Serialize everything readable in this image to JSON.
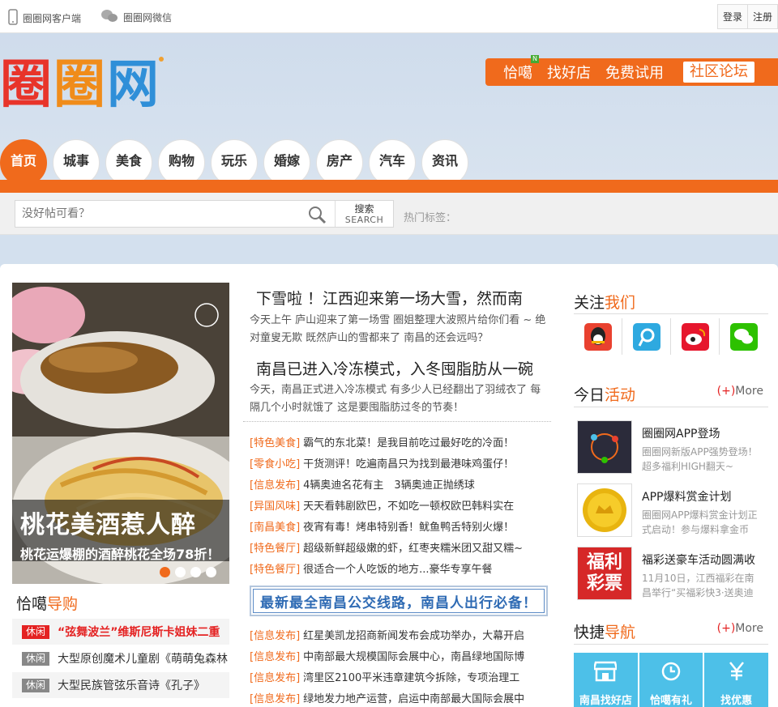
{
  "topbar": {
    "client": "圈圈网客户端",
    "wechat": "圈圈网微信",
    "login": "登录",
    "register": "注册"
  },
  "logo": {
    "chars": [
      "圈",
      "圈",
      "网"
    ]
  },
  "topnav": {
    "items": [
      "恰噶",
      "找好店",
      "免费试用",
      "社区论坛"
    ],
    "badge": "N"
  },
  "mainnav": [
    "首页",
    "城事",
    "美食",
    "购物",
    "玩乐",
    "婚嫁",
    "房产",
    "汽车",
    "资讯"
  ],
  "search": {
    "placeholder": "没好帖可看？",
    "button": "搜索",
    "button_en": "SEARCH",
    "hot_label": "热门标签："
  },
  "slider": {
    "title": "桃花美酒惹人醉",
    "subtitle": "桃花运爆棚的酒醉桃花全场78折！"
  },
  "left_section": {
    "title_a": "恰噶",
    "title_b": "导购",
    "items": [
      {
        "tag": "休闲",
        "text": "“弦舞波兰”维斯尼斯卡姐妹二重"
      },
      {
        "tag": "休闲",
        "text": "大型原创魔术儿童剧《萌萌兔森林"
      },
      {
        "tag": "休闲",
        "text": "大型民族管弦乐音诗《孔子》"
      }
    ]
  },
  "news": [
    {
      "title": "下雪啦 ！江西迎来第一场大雪，然而南",
      "summary": "今天上午 庐山迎来了第一场雪 圈姐整理大波照片给你们看 ~ 绝对童叟无欺 既然庐山的雪都来了 南昌的还会远吗？"
    },
    {
      "title": "南昌已进入冷冻模式，入冬囤脂肪从一碗",
      "summary": "今天，南昌正式进入冷冻模式 有多少人已经翻出了羽绒衣了 每隔几个小时就饿了 这是要囤脂肪过冬的节奏！"
    }
  ],
  "mid_list": [
    {
      "tag": "[特色美食]",
      "text": "霸气的东北菜！是我目前吃过最好吃的冷面！"
    },
    {
      "tag": "[零食小吃]",
      "text": "干货测评！吃遍南昌只为找到最港味鸡蛋仔！"
    },
    {
      "tag": "[信息发布]",
      "text": "4辆奥迪名花有主　3辆奥迪正抛绣球"
    },
    {
      "tag": "[异国风味]",
      "text": "天天看韩剧欧巴，不如吃一顿权欧巴韩料实在"
    },
    {
      "tag": "[南昌美食]",
      "text": "夜宵有毒！烤串特别香！鱿鱼鸭舌特别火爆！"
    },
    {
      "tag": "[特色餐厅]",
      "text": "超级新鲜超级嫩的虾，红枣夹糯米团又甜又糯~"
    },
    {
      "tag": "[特色餐厅]",
      "text": "很适合一个人吃饭的地方...豪华专享午餐"
    }
  ],
  "banner": "最新最全南昌公交线路，南昌人出行必备！",
  "mid_list2": [
    {
      "tag": "[信息发布]",
      "text": "红星美凯龙招商新闻发布会成功举办，大幕开启"
    },
    {
      "tag": "[信息发布]",
      "text": "中南部最大规模国际会展中心，南昌绿地国际博"
    },
    {
      "tag": "[信息发布]",
      "text": "湾里区2100平米违章建筑今拆除，专项治理工"
    },
    {
      "tag": "[信息发布]",
      "text": "绿地发力地产运营，启运中南部最大国际会展中"
    }
  ],
  "follow": {
    "title_a": "关注",
    "title_b": "我们",
    "icons": [
      "qq-icon",
      "tencent-weibo-icon",
      "sina-weibo-icon",
      "wechat-icon"
    ]
  },
  "activity": {
    "title_a": "今日",
    "title_b": "活动",
    "more_plus": "(+)",
    "more": "More",
    "items": [
      {
        "title": "圈圈网APP登场",
        "desc": "圈圈网新版APP强势登场！超多福利HIGH翻天~"
      },
      {
        "title": "APP爆料赏金计划",
        "desc": "圈圈网APP爆料赏金计划正式启动！参与爆料拿金币"
      },
      {
        "title": "福彩送豪车活动圆满收",
        "desc": "11月10日，江西福彩在南昌举行“买福彩快3·送奥迪",
        "pic_text": "福利彩票"
      }
    ]
  },
  "quick": {
    "title_a": "快捷",
    "title_b": "导航",
    "more_plus": "(+)",
    "more": "More",
    "items": [
      "南昌找好店",
      "恰噶有礼",
      "找优惠"
    ]
  },
  "colors": {
    "accent": "#f06a1c",
    "link_blue": "#2f6bb4",
    "quick_bg": "#4dc0e8",
    "red": "#e42222"
  }
}
